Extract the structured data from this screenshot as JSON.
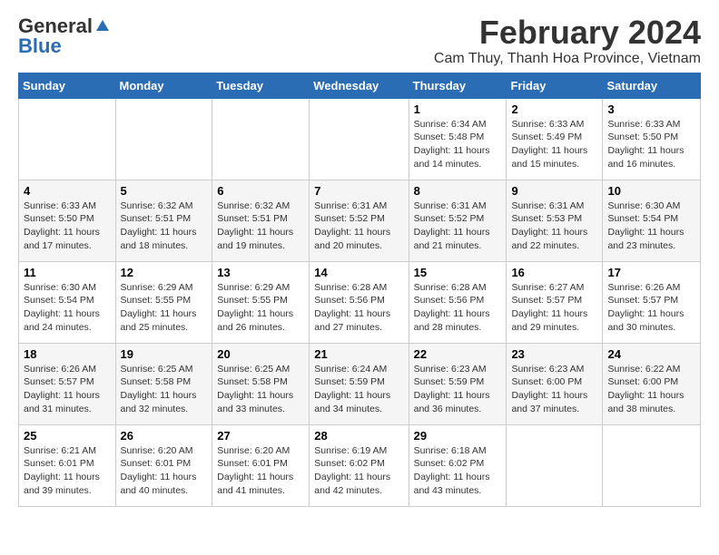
{
  "logo": {
    "general": "General",
    "blue": "Blue"
  },
  "title": "February 2024",
  "subtitle": "Cam Thuy, Thanh Hoa Province, Vietnam",
  "headers": [
    "Sunday",
    "Monday",
    "Tuesday",
    "Wednesday",
    "Thursday",
    "Friday",
    "Saturday"
  ],
  "weeks": [
    [
      {
        "day": "",
        "info": ""
      },
      {
        "day": "",
        "info": ""
      },
      {
        "day": "",
        "info": ""
      },
      {
        "day": "",
        "info": ""
      },
      {
        "day": "1",
        "info": "Sunrise: 6:34 AM\nSunset: 5:48 PM\nDaylight: 11 hours and 14 minutes."
      },
      {
        "day": "2",
        "info": "Sunrise: 6:33 AM\nSunset: 5:49 PM\nDaylight: 11 hours and 15 minutes."
      },
      {
        "day": "3",
        "info": "Sunrise: 6:33 AM\nSunset: 5:50 PM\nDaylight: 11 hours and 16 minutes."
      }
    ],
    [
      {
        "day": "4",
        "info": "Sunrise: 6:33 AM\nSunset: 5:50 PM\nDaylight: 11 hours and 17 minutes."
      },
      {
        "day": "5",
        "info": "Sunrise: 6:32 AM\nSunset: 5:51 PM\nDaylight: 11 hours and 18 minutes."
      },
      {
        "day": "6",
        "info": "Sunrise: 6:32 AM\nSunset: 5:51 PM\nDaylight: 11 hours and 19 minutes."
      },
      {
        "day": "7",
        "info": "Sunrise: 6:31 AM\nSunset: 5:52 PM\nDaylight: 11 hours and 20 minutes."
      },
      {
        "day": "8",
        "info": "Sunrise: 6:31 AM\nSunset: 5:52 PM\nDaylight: 11 hours and 21 minutes."
      },
      {
        "day": "9",
        "info": "Sunrise: 6:31 AM\nSunset: 5:53 PM\nDaylight: 11 hours and 22 minutes."
      },
      {
        "day": "10",
        "info": "Sunrise: 6:30 AM\nSunset: 5:54 PM\nDaylight: 11 hours and 23 minutes."
      }
    ],
    [
      {
        "day": "11",
        "info": "Sunrise: 6:30 AM\nSunset: 5:54 PM\nDaylight: 11 hours and 24 minutes."
      },
      {
        "day": "12",
        "info": "Sunrise: 6:29 AM\nSunset: 5:55 PM\nDaylight: 11 hours and 25 minutes."
      },
      {
        "day": "13",
        "info": "Sunrise: 6:29 AM\nSunset: 5:55 PM\nDaylight: 11 hours and 26 minutes."
      },
      {
        "day": "14",
        "info": "Sunrise: 6:28 AM\nSunset: 5:56 PM\nDaylight: 11 hours and 27 minutes."
      },
      {
        "day": "15",
        "info": "Sunrise: 6:28 AM\nSunset: 5:56 PM\nDaylight: 11 hours and 28 minutes."
      },
      {
        "day": "16",
        "info": "Sunrise: 6:27 AM\nSunset: 5:57 PM\nDaylight: 11 hours and 29 minutes."
      },
      {
        "day": "17",
        "info": "Sunrise: 6:26 AM\nSunset: 5:57 PM\nDaylight: 11 hours and 30 minutes."
      }
    ],
    [
      {
        "day": "18",
        "info": "Sunrise: 6:26 AM\nSunset: 5:57 PM\nDaylight: 11 hours and 31 minutes."
      },
      {
        "day": "19",
        "info": "Sunrise: 6:25 AM\nSunset: 5:58 PM\nDaylight: 11 hours and 32 minutes."
      },
      {
        "day": "20",
        "info": "Sunrise: 6:25 AM\nSunset: 5:58 PM\nDaylight: 11 hours and 33 minutes."
      },
      {
        "day": "21",
        "info": "Sunrise: 6:24 AM\nSunset: 5:59 PM\nDaylight: 11 hours and 34 minutes."
      },
      {
        "day": "22",
        "info": "Sunrise: 6:23 AM\nSunset: 5:59 PM\nDaylight: 11 hours and 36 minutes."
      },
      {
        "day": "23",
        "info": "Sunrise: 6:23 AM\nSunset: 6:00 PM\nDaylight: 11 hours and 37 minutes."
      },
      {
        "day": "24",
        "info": "Sunrise: 6:22 AM\nSunset: 6:00 PM\nDaylight: 11 hours and 38 minutes."
      }
    ],
    [
      {
        "day": "25",
        "info": "Sunrise: 6:21 AM\nSunset: 6:01 PM\nDaylight: 11 hours and 39 minutes."
      },
      {
        "day": "26",
        "info": "Sunrise: 6:20 AM\nSunset: 6:01 PM\nDaylight: 11 hours and 40 minutes."
      },
      {
        "day": "27",
        "info": "Sunrise: 6:20 AM\nSunset: 6:01 PM\nDaylight: 11 hours and 41 minutes."
      },
      {
        "day": "28",
        "info": "Sunrise: 6:19 AM\nSunset: 6:02 PM\nDaylight: 11 hours and 42 minutes."
      },
      {
        "day": "29",
        "info": "Sunrise: 6:18 AM\nSunset: 6:02 PM\nDaylight: 11 hours and 43 minutes."
      },
      {
        "day": "",
        "info": ""
      },
      {
        "day": "",
        "info": ""
      }
    ]
  ]
}
